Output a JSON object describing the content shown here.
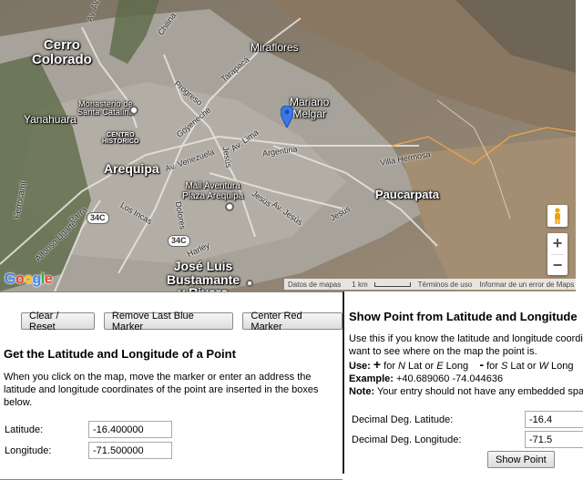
{
  "map": {
    "places": {
      "cerro_colorado": "Cerro\nColorado",
      "miraflores": "Miraflores",
      "mariano_melgar": "Mariano\nMelgar",
      "yanahuara": "Yanahuara",
      "monasterio": "Monasterio de\nSanta Catalina",
      "centro_historico": "CENTRO\nHISTÓRICO",
      "arequipa": "Arequipa",
      "paucarpata": "Paucarpata",
      "mall_aventura": "Mall Aventura\nPlaza Arequipa",
      "jose_luis": "José Luis\nBustamante\ny Rivero"
    },
    "roads": {
      "av_aviacion": "Av. Aviación",
      "chilina": "Chilina",
      "tarapaca": "Tarapacá",
      "progreso": "Progreso",
      "goyeneche": "Goyeneche",
      "av_lima": "Av. Lima",
      "argentina": "Argentina",
      "villa_hermosa": "Villa Hermosa",
      "av_venezuela": "Av. Venezuela",
      "jesus": "Jesús",
      "jesus2": "Jesús",
      "jesus3": "Jesús",
      "av_jesus": "Av. Jesús",
      "los_incas": "Los Incas",
      "dolores": "Dolores",
      "harley": "Harley",
      "parra": "Parra",
      "ferrocarril": "Ferrocarril",
      "alfonso_ugarte": "Alfonso Ugarte"
    },
    "shields": {
      "s1": "34C",
      "s2": "34C"
    },
    "logo": "Google",
    "attribution": {
      "data": "Datos de mapas",
      "scale": "1 km",
      "terms": "Términos de uso",
      "report": "Informar de un error de Maps"
    },
    "zoom_in": "+",
    "zoom_out": "−",
    "colors": {
      "marker": "#3b78e7",
      "pegman": "#f0a10a"
    }
  },
  "left": {
    "buttons": {
      "clear": "Clear / Reset",
      "remove_blue": "Remove Last Blue Marker",
      "center_red": "Center Red Marker"
    },
    "heading": "Get the Latitude and Longitude of a Point",
    "description": "When you click on the map, move the marker or enter an address the latitude and longitude coordinates of the point are inserted in the boxes below.",
    "latitude_label": "Latitude:",
    "latitude_value": "-16.400000",
    "longitude_label": "Longitude:",
    "longitude_value": "-71.500000"
  },
  "right": {
    "heading": "Show Point from Latitude and Longitude",
    "intro_line1": "Use this if you know the latitude and longitude coordinates and",
    "intro_line2": "want to see where on the map the point is.",
    "use_label": "Use:",
    "use_plus_sym": "+",
    "use_for": " for ",
    "use_n": "N",
    "use_lat_or": " Lat or ",
    "use_e": "E",
    "use_long": " Long",
    "use_minus_sym": "-",
    "use_for2": " for ",
    "use_s": "S",
    "use_lat_or2": " Lat or ",
    "use_w": "W",
    "use_long2": " Long",
    "example_label": "Example:",
    "example_value": " +40.689060  -74.044636",
    "note_label": "Note:",
    "note_text": " Your entry should not have any embedded spaces.",
    "dec_lat_label": "Decimal Deg. Latitude:",
    "dec_lat_value": "-16.4",
    "dec_lon_label": "Decimal Deg. Longitude:",
    "dec_lon_value": "-71.5",
    "show_button": "Show Point"
  }
}
